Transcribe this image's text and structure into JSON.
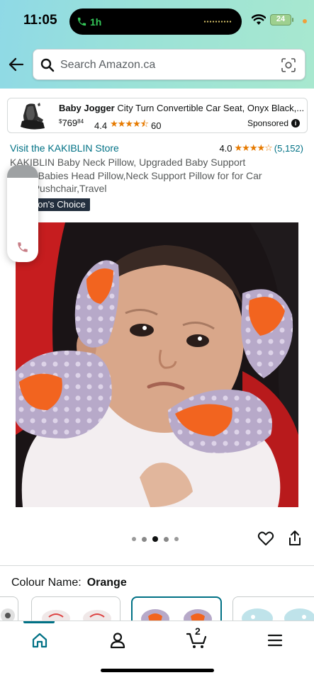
{
  "status_bar": {
    "time": "11:05",
    "call_duration": "1h",
    "battery": "24"
  },
  "search": {
    "placeholder": "Search Amazon.ca"
  },
  "sponsored_ad": {
    "brand": "Baby Jogger",
    "title_rest": " City Turn Convertible Car Seat, Onyx Black,...",
    "price_currency": "$",
    "price_whole": "769",
    "price_fraction": "84",
    "rating": "4.4",
    "stars": "★★★★⯪",
    "review_count": "60",
    "label": "Sponsored"
  },
  "product": {
    "store_link": "Visit the KAKIBLIN Store",
    "rating": "4.0",
    "stars": "★★★★☆",
    "review_count": "(5,152)",
    "title_line1": "KAKIBLIN Baby Neck Pillow, Upgraded Baby Support",
    "title_line2": "Pillow,Babies Head Pillow,Neck Support Pillow for for Car",
    "title_line3": "Seat Pushchair,Travel",
    "badge": "Amazon's Choice"
  },
  "carousel": {
    "dot_count": 5,
    "active_index": 2
  },
  "colour": {
    "label": "Colour Name:",
    "value": "Orange"
  },
  "bottom_nav": {
    "cart_count": "2",
    "items": [
      "home-icon",
      "account-icon",
      "cart-icon",
      "menu-icon"
    ]
  },
  "colors": {
    "link": "#007185",
    "star": "#e67a00",
    "badge_bg": "#232f3e",
    "header_gradient_start": "#8fd9e6",
    "header_gradient_end": "#a8e8cf"
  }
}
